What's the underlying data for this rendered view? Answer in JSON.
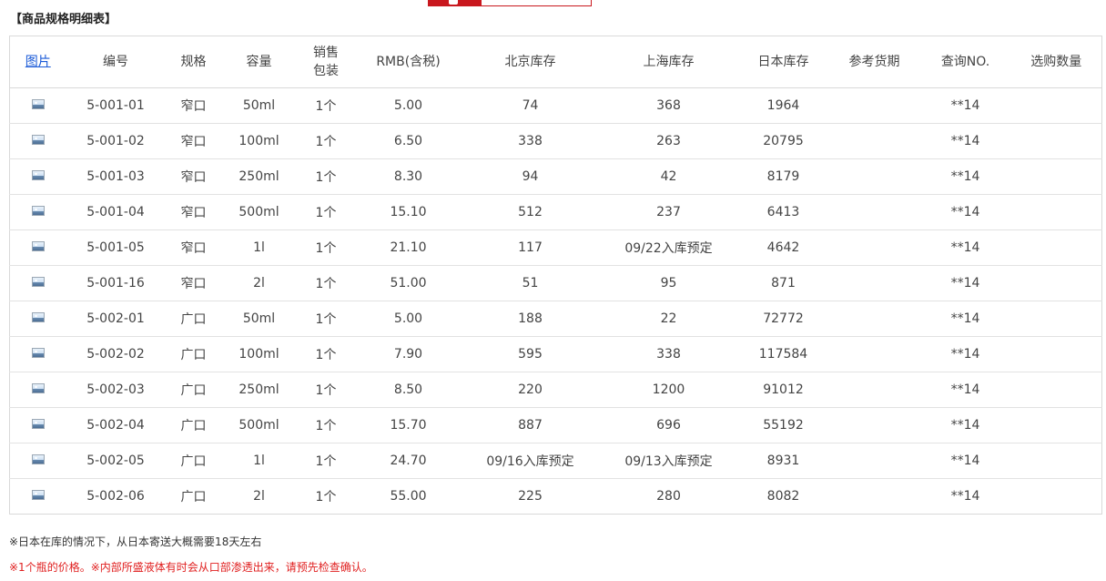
{
  "page": {
    "title": "【商品规格明细表】"
  },
  "table": {
    "headers": {
      "image": "图片",
      "code": "编号",
      "spec": "规格",
      "capacity": "容量",
      "package_line1": "销售",
      "package_line2": "包装",
      "price": "RMB(含税)",
      "beijing": "北京库存",
      "shanghai": "上海库存",
      "japan": "日本库存",
      "delivery": "参考货期",
      "query": "查询NO.",
      "quantity": "选购数量"
    },
    "rows": [
      {
        "code": "5-001-01",
        "spec": "窄口",
        "capacity": "50ml",
        "package": "1个",
        "price": "5.00",
        "beijing": "74",
        "shanghai": "368",
        "japan": "1964",
        "delivery": "",
        "query": "**14"
      },
      {
        "code": "5-001-02",
        "spec": "窄口",
        "capacity": "100ml",
        "package": "1个",
        "price": "6.50",
        "beijing": "338",
        "shanghai": "263",
        "japan": "20795",
        "delivery": "",
        "query": "**14"
      },
      {
        "code": "5-001-03",
        "spec": "窄口",
        "capacity": "250ml",
        "package": "1个",
        "price": "8.30",
        "beijing": "94",
        "shanghai": "42",
        "japan": "8179",
        "delivery": "",
        "query": "**14"
      },
      {
        "code": "5-001-04",
        "spec": "窄口",
        "capacity": "500ml",
        "package": "1个",
        "price": "15.10",
        "beijing": "512",
        "shanghai": "237",
        "japan": "6413",
        "delivery": "",
        "query": "**14"
      },
      {
        "code": "5-001-05",
        "spec": "窄口",
        "capacity": "1l",
        "package": "1个",
        "price": "21.10",
        "beijing": "117",
        "shanghai": "09/22入库预定",
        "japan": "4642",
        "delivery": "",
        "query": "**14"
      },
      {
        "code": "5-001-16",
        "spec": "窄口",
        "capacity": "2l",
        "package": "1个",
        "price": "51.00",
        "beijing": "51",
        "shanghai": "95",
        "japan": "871",
        "delivery": "",
        "query": "**14"
      },
      {
        "code": "5-002-01",
        "spec": "广口",
        "capacity": "50ml",
        "package": "1个",
        "price": "5.00",
        "beijing": "188",
        "shanghai": "22",
        "japan": "72772",
        "delivery": "",
        "query": "**14"
      },
      {
        "code": "5-002-02",
        "spec": "广口",
        "capacity": "100ml",
        "package": "1个",
        "price": "7.90",
        "beijing": "595",
        "shanghai": "338",
        "japan": "117584",
        "delivery": "",
        "query": "**14"
      },
      {
        "code": "5-002-03",
        "spec": "广口",
        "capacity": "250ml",
        "package": "1个",
        "price": "8.50",
        "beijing": "220",
        "shanghai": "1200",
        "japan": "91012",
        "delivery": "",
        "query": "**14"
      },
      {
        "code": "5-002-04",
        "spec": "广口",
        "capacity": "500ml",
        "package": "1个",
        "price": "15.70",
        "beijing": "887",
        "shanghai": "696",
        "japan": "55192",
        "delivery": "",
        "query": "**14"
      },
      {
        "code": "5-002-05",
        "spec": "广口",
        "capacity": "1l",
        "package": "1个",
        "price": "24.70",
        "beijing": "09/16入库预定",
        "shanghai": "09/13入库预定",
        "japan": "8931",
        "delivery": "",
        "query": "**14"
      },
      {
        "code": "5-002-06",
        "spec": "广口",
        "capacity": "2l",
        "package": "1个",
        "price": "55.00",
        "beijing": "225",
        "shanghai": "280",
        "japan": "8082",
        "delivery": "",
        "query": "**14"
      }
    ]
  },
  "notes": {
    "japan_shipping": "※日本在库的情况下，从日本寄送大概需要18天左右",
    "price_note": "※1个瓶的价格。※内部所盛液体有时会从口部渗透出来，请预先检查确认。"
  },
  "colors": {
    "price": "#d0021b",
    "link": "#1a5ad7",
    "warning_note": "#e02020",
    "banner": "#c9181e"
  },
  "icons": {
    "row_image": "image-thumbnail-icon"
  }
}
